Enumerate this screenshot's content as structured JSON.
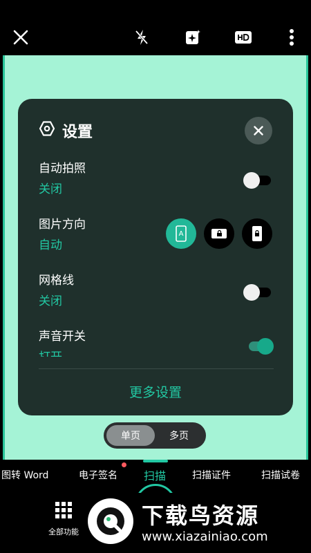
{
  "settings": {
    "title": "设置",
    "rows": [
      {
        "label": "自动拍照",
        "value": "关闭",
        "toggle_on": false
      },
      {
        "label": "图片方向",
        "value": "自动"
      },
      {
        "label": "网格线",
        "value": "关闭",
        "toggle_on": false
      },
      {
        "label": "声音开关",
        "value": "打开",
        "toggle_on": true
      }
    ],
    "orientation_options": [
      "auto",
      "landscape",
      "portrait"
    ],
    "orientation_selected": "auto",
    "orientation_auto_glyph": "A",
    "more_label": "更多设置"
  },
  "page_mode": {
    "single": "单页",
    "multi": "多页",
    "selected": "single"
  },
  "tabs": [
    {
      "label": "图转 Word"
    },
    {
      "label": "电子签名",
      "badge": true
    },
    {
      "label": "扫描",
      "active": true
    },
    {
      "label": "扫描证件"
    },
    {
      "label": "扫描试卷"
    }
  ],
  "bottom": {
    "all_functions": "全部功能"
  },
  "watermark": {
    "title": "下载鸟资源",
    "url": "www.xiazainiao.com"
  },
  "colors": {
    "accent": "#22c8a3",
    "viewfinder": "#a5f3d6",
    "panel": "#1f302c"
  },
  "icons": [
    "close-icon",
    "flash-off-icon",
    "magic-enhance-icon",
    "hd-icon",
    "more-vertical-icon",
    "settings-hex-icon",
    "grid-icon"
  ]
}
